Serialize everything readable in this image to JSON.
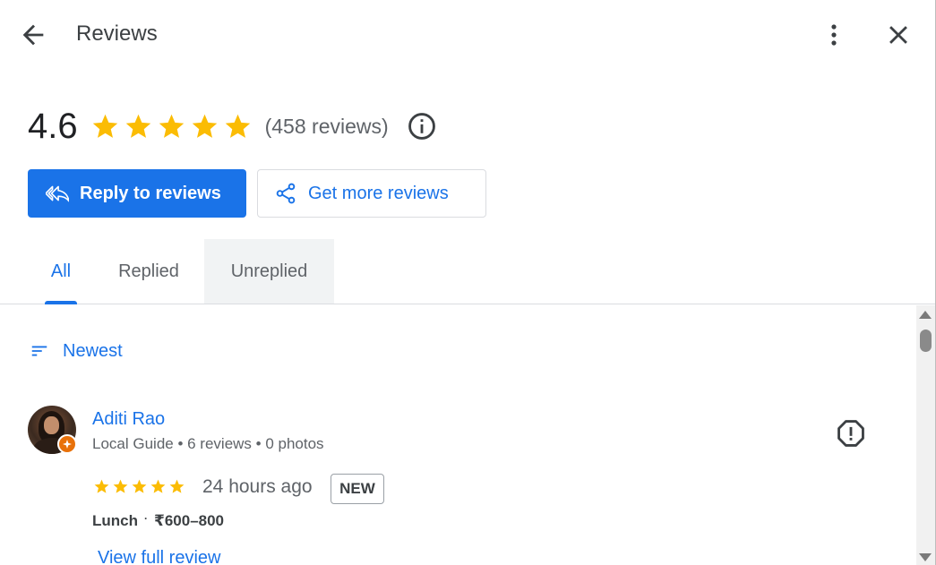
{
  "header": {
    "title": "Reviews",
    "back_icon": "arrow-back-icon",
    "more_icon": "more-vert-icon",
    "close_icon": "close-icon"
  },
  "summary": {
    "rating": "4.6",
    "stars_filled": 5,
    "review_count": "(458 reviews)",
    "info_icon": "info-icon",
    "star_color": "#fbbc04"
  },
  "actions": {
    "reply_label": "Reply to reviews",
    "get_more_label": "Get more reviews"
  },
  "tabs": [
    {
      "label": "All",
      "selected": true
    },
    {
      "label": "Replied",
      "selected": false
    },
    {
      "label": "Unreplied",
      "selected": false
    }
  ],
  "sort": {
    "label": "Newest",
    "icon": "sort-icon"
  },
  "reviews": [
    {
      "name": "Aditi Rao",
      "meta": "Local Guide • 6 reviews • 0 photos",
      "stars": 5,
      "time": "24 hours ago",
      "badge": "NEW",
      "meal": "Lunch",
      "price": "₹600–800",
      "view_full": "View full review"
    }
  ],
  "colors": {
    "accent": "#1a73e8",
    "text": "#3c4043",
    "muted": "#5f6368",
    "guide_badge": "#e8710a"
  }
}
